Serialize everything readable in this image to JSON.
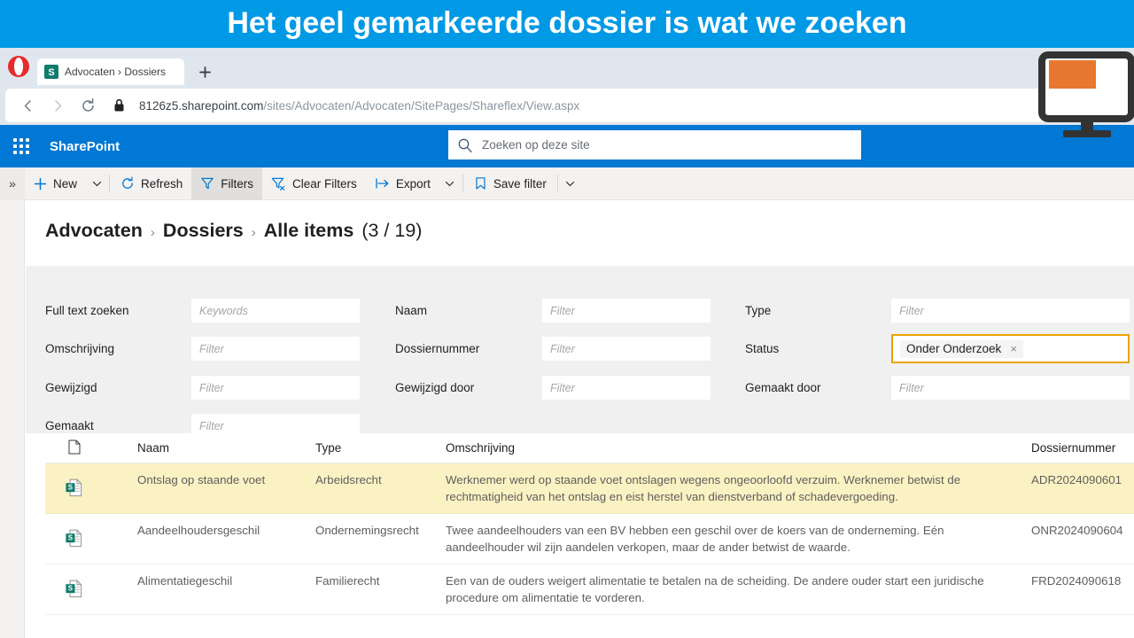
{
  "banner": {
    "text": "Het geel gemarkeerde dossier is wat we zoeken",
    "bg": "#0099E5"
  },
  "browser": {
    "name": "opera-logo",
    "tab": {
      "title": "Advocaten › Dossiers",
      "favicon": "sharepoint-icon"
    },
    "new_tab_label": "+",
    "back_label": "‹",
    "forward_label": "›",
    "reload_label": "↻",
    "url_domain": "8126z5.sharepoint.com",
    "url_path": "/sites/Advocaten/Advocaten/SitePages/Shareflex/View.aspx"
  },
  "suitebar": {
    "brand": "SharePoint",
    "waffle": "app-launcher-icon",
    "bg": "#0078d4"
  },
  "search": {
    "placeholder": "Zoeken op deze site",
    "icon": "search-icon"
  },
  "toolbar": {
    "overflow_label": "»",
    "items": [
      {
        "label": "New",
        "icon": "plus-icon",
        "caret": true,
        "selected": false
      },
      {
        "label": "Refresh",
        "icon": "refresh-icon",
        "caret": false,
        "selected": false
      },
      {
        "label": "Filters",
        "icon": "funnel-icon",
        "caret": false,
        "selected": true
      },
      {
        "label": "Clear Filters",
        "icon": "funnel-clear-icon",
        "caret": false,
        "selected": false
      },
      {
        "label": "Export",
        "icon": "export-icon",
        "caret": true,
        "selected": false
      },
      {
        "label": "Save filter",
        "icon": "bookmark-icon",
        "caret": true,
        "selected": false
      }
    ]
  },
  "breadcrumb": {
    "crumbs": [
      "Advocaten",
      "Dossiers",
      "Alle items"
    ],
    "separator": "›",
    "count": "(3 / 19)"
  },
  "filters": {
    "accent": "#eaa300",
    "fields": [
      {
        "label": "Full text zoeken",
        "placeholder": "Keywords",
        "value": "",
        "col": 0,
        "row": 0
      },
      {
        "label": "Omschrijving",
        "placeholder": "Filter",
        "value": "",
        "col": 0,
        "row": 1
      },
      {
        "label": "Gewijzigd",
        "placeholder": "Filter",
        "value": "",
        "col": 0,
        "row": 2
      },
      {
        "label": "Gemaakt",
        "placeholder": "Filter",
        "value": "",
        "col": 0,
        "row": 3
      },
      {
        "label": "Naam",
        "placeholder": "Filter",
        "value": "",
        "col": 1,
        "row": 0
      },
      {
        "label": "Dossiernummer",
        "placeholder": "Filter",
        "value": "",
        "col": 1,
        "row": 1
      },
      {
        "label": "Gewijzigd door",
        "placeholder": "Filter",
        "value": "",
        "col": 1,
        "row": 2
      },
      {
        "label": "Type",
        "placeholder": "Filter",
        "value": "",
        "col": 2,
        "row": 0
      },
      {
        "label": "Status",
        "placeholder": "",
        "value": "Onder Onderzoek",
        "highlighted": true,
        "remove": "×",
        "col": 2,
        "row": 1
      },
      {
        "label": "Gemaakt door",
        "placeholder": "Filter",
        "value": "",
        "col": 2,
        "row": 2
      }
    ]
  },
  "table": {
    "columns": [
      {
        "key": "icon",
        "label": "",
        "icon": "document-icon"
      },
      {
        "key": "naam",
        "label": "Naam"
      },
      {
        "key": "type",
        "label": "Type"
      },
      {
        "key": "omschrijving",
        "label": "Omschrijving"
      },
      {
        "key": "dossiernummer",
        "label": "Dossiernummer"
      }
    ],
    "rows": [
      {
        "icon": "sharepoint-document-icon",
        "naam": "Ontslag op staande voet",
        "type": "Arbeidsrecht",
        "omschrijving": "Werknemer werd op staande voet ontslagen wegens ongeoorloofd verzuim. Werknemer betwist de rechtmatigheid van het ontslag en eist herstel van dienstverband of schadevergoeding.",
        "dossiernummer": "ADR2024090601",
        "highlighted": true
      },
      {
        "icon": "sharepoint-document-icon",
        "naam": "Aandeelhoudersgeschil",
        "type": "Ondernemingsrecht",
        "omschrijving": "Twee aandeelhouders van een BV hebben een geschil over de koers van de onderneming. Eén aandeelhouder wil zijn aandelen verkopen, maar de ander betwist de waarde.",
        "dossiernummer": "ONR2024090604",
        "highlighted": false
      },
      {
        "icon": "sharepoint-document-icon",
        "naam": "Alimentatiegeschil",
        "type": "Familierecht",
        "omschrijving": "Een van de ouders weigert alimentatie te betalen na de scheiding. De andere ouder start een juridische procedure om alimentatie te vorderen.",
        "dossiernummer": "FRD2024090618",
        "highlighted": false
      }
    ],
    "highlight_color": "#fbf2c4"
  }
}
